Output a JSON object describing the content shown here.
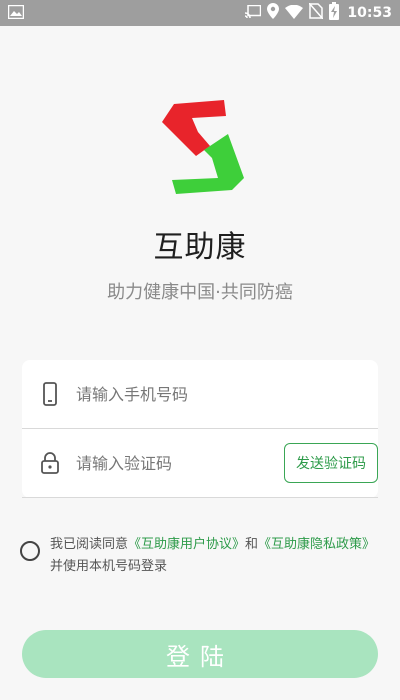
{
  "status_bar": {
    "time": "10:53",
    "icons": [
      "image-icon",
      "cast-icon",
      "location-icon",
      "wifi-icon",
      "no-sim-icon",
      "battery-charging-icon"
    ]
  },
  "app": {
    "logo": "app-logo-icon",
    "title": "互助康",
    "subtitle": "助力健康中国·共同防癌"
  },
  "form": {
    "phone": {
      "icon": "phone-icon",
      "placeholder": "请输入手机号码",
      "value": ""
    },
    "code": {
      "icon": "lock-icon",
      "placeholder": "请输入验证码",
      "value": ""
    },
    "send_code_label": "发送验证码"
  },
  "agreement": {
    "checked": false,
    "prefix": "我已阅读同意",
    "user_agreement": "《互助康用户协议》",
    "and": "和",
    "privacy_policy": "《互助康隐私政策》",
    "suffix": "并使用本机号码登录"
  },
  "login": {
    "label": "登陆"
  },
  "colors": {
    "accent": "#2e9b4a",
    "login_button": "#a9e4bf",
    "status_bar": "#9e9e9e",
    "logo_red": "#e8242b",
    "logo_green": "#3ecf3a"
  }
}
